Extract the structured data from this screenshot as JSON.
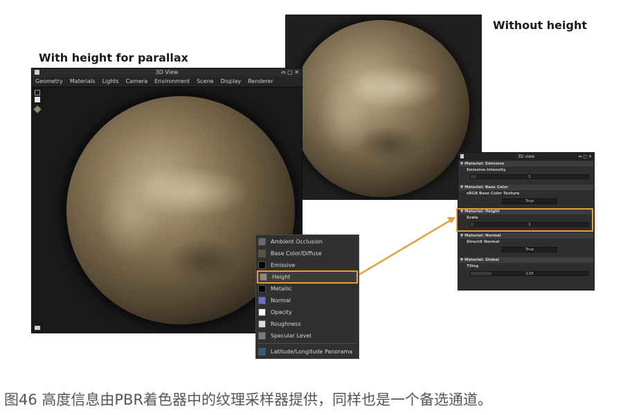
{
  "labels": {
    "with_height": "With height for parallax",
    "without_height": "Without height"
  },
  "left_window": {
    "title": "3D View",
    "controls": "⇔ ▢ ✕",
    "menu": [
      "Geometry",
      "Materials",
      "Lights",
      "Camera",
      "Environment",
      "Scene",
      "Display",
      "Renderer"
    ]
  },
  "channel_menu": {
    "items": [
      {
        "label": "Ambient Occlusion",
        "swatch": "#6a6a6a"
      },
      {
        "label": "Base Color/Diffuse",
        "swatch": "#5b5140"
      },
      {
        "label": "Emissive",
        "swatch": "#000000"
      },
      {
        "label": "Height",
        "swatch": "#8a8a8a"
      },
      {
        "label": "Metallic",
        "swatch": "#000000"
      },
      {
        "label": "Normal",
        "swatch": "#6f6fd0"
      },
      {
        "label": "Opacity",
        "swatch": "#ffffff"
      },
      {
        "label": "Roughness",
        "swatch": "#dcdcdc"
      },
      {
        "label": "Specular Level",
        "swatch": "#7a7a7a"
      },
      {
        "label": "Latitude/Longitude Panorama",
        "swatch": "#3a5a7a"
      }
    ],
    "selected": "Height"
  },
  "props_panel": {
    "title": "3D view",
    "controls": "⇔ ▢ ✕",
    "sections": {
      "emissive": "▼  Material: Emissive",
      "base_color": "▼  Material: Base Color",
      "height": "▼  Material: Height",
      "normal": "▼  Material: Normal",
      "global": "▼  Material: Global"
    },
    "emissive_intensity_label": "Emissive Intensity",
    "emissive_intensity_value": "1",
    "srgb_label": "sRGB Base Color Texture",
    "srgb_value": "True",
    "scale_label": "Scale",
    "scale_value": "1",
    "directx_label": "DirectX Normal",
    "directx_value": "True",
    "tiling_label": "Tiling",
    "tiling_value": "2.55"
  },
  "accent_color": "#e3a03a",
  "caption": "图46 高度信息由PBR着色器中的纹理采样器提供，同样也是一个备选通道。"
}
